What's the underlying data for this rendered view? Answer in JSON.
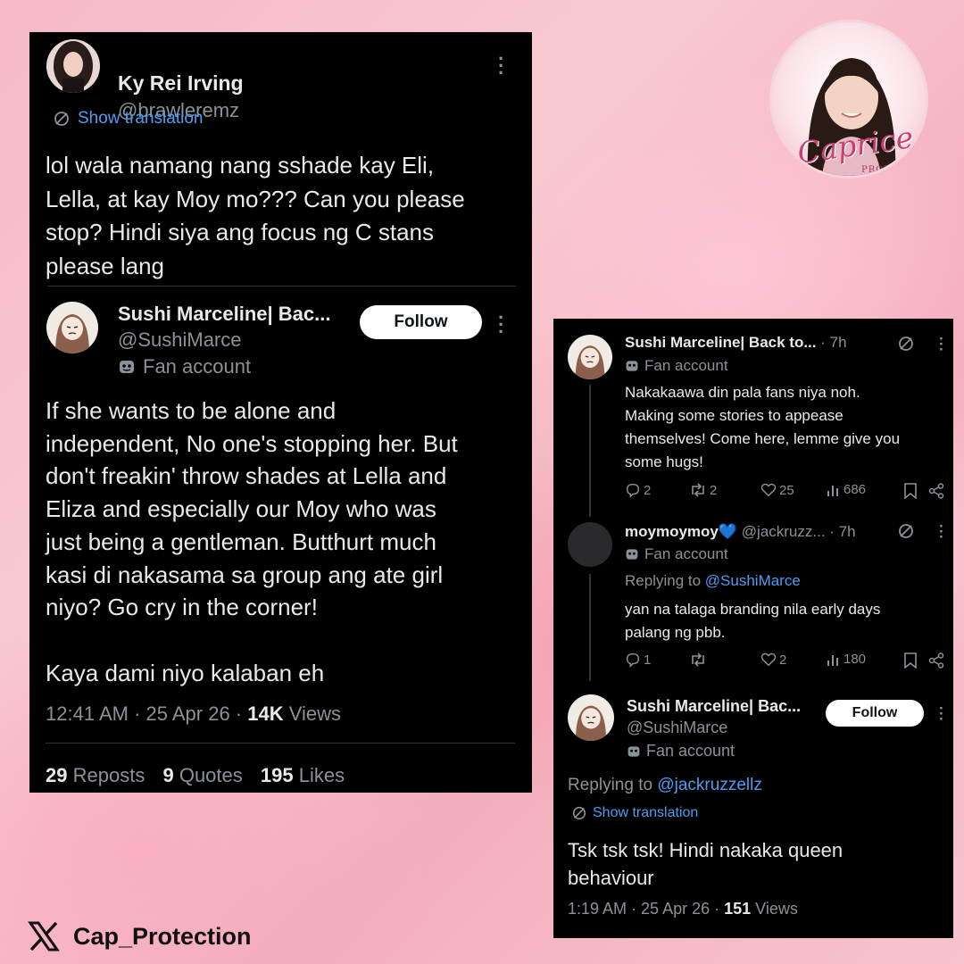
{
  "left": {
    "author": {
      "name": "Ky Rei Irving",
      "handle": "@brawleremz"
    },
    "translation_label": "Show translation",
    "text": "lol wala namang nang sshade kay Eli,\nLella, at kay Moy mo??? Can you please\nstop? Hindi siya ang focus ng C stans\nplease lang",
    "quoted": {
      "name": "Sushi Marceline| Bac...",
      "handle": "@SushiMarce",
      "follow_label": "Follow",
      "badge": "Fan account",
      "text": "If she wants to be alone and\nindependent, No one's stopping her. But\ndon't freakin' throw shades at Lella and\nEliza and especially our Moy who was\njust being a gentleman. Butthurt much\nkasi di nakasama sa group ang ate girl\nniyo? Go cry in the corner!\n\nKaya dami niyo kalaban eh"
    },
    "meta": {
      "time": "12:41 AM · 25 Apr 26 · ",
      "views_count": "14K",
      "views_label": " Views"
    },
    "stats": [
      {
        "count": "29",
        "label": "Reposts"
      },
      {
        "count": "9",
        "label": "Quotes"
      },
      {
        "count": "195",
        "label": "Likes"
      }
    ]
  },
  "right": {
    "reply1": {
      "name": "Sushi Marceline| Back to...",
      "time": "· 7h",
      "badge": "Fan account",
      "text": "Nakakaawa din pala fans niya noh.\nMaking some stories to appease\nthemselves! Come here, lemme give you\nsome hugs!",
      "replies": "2",
      "reposts": "2",
      "likes": "25",
      "views": "686"
    },
    "reply2": {
      "name": "moymoymoy💙",
      "handle": "@jackruzz...",
      "time": "· 7h",
      "badge": "Fan account",
      "replying_prefix": "Replying to ",
      "replying_to": "@SushiMarce",
      "text": "yan na talaga branding nila early days\npalang ng pbb.",
      "replies": "1",
      "reposts": "",
      "likes": "2",
      "views": "180"
    },
    "main": {
      "name": "Sushi Marceline| Bac...",
      "handle": "@SushiMarce",
      "follow_label": "Follow",
      "badge": "Fan account",
      "replying_prefix": "Replying to ",
      "replying_to": "@jackruzzellz",
      "translation_label": "Show translation",
      "text": "Tsk tsk tsk! Hindi nakaka queen\nbehaviour",
      "meta_time": "1:19 AM · 25 Apr 26 · ",
      "views_count": "151",
      "views_label": " Views"
    }
  },
  "logo": {
    "script": "Caprice",
    "sub": "PROTECTIO"
  },
  "brand": {
    "handle": "Cap_Protection"
  },
  "colors": {
    "link": "#4d9df0",
    "card_bg": "#000000",
    "muted": "#8b9199",
    "background_pink": "#f6b9c6"
  }
}
